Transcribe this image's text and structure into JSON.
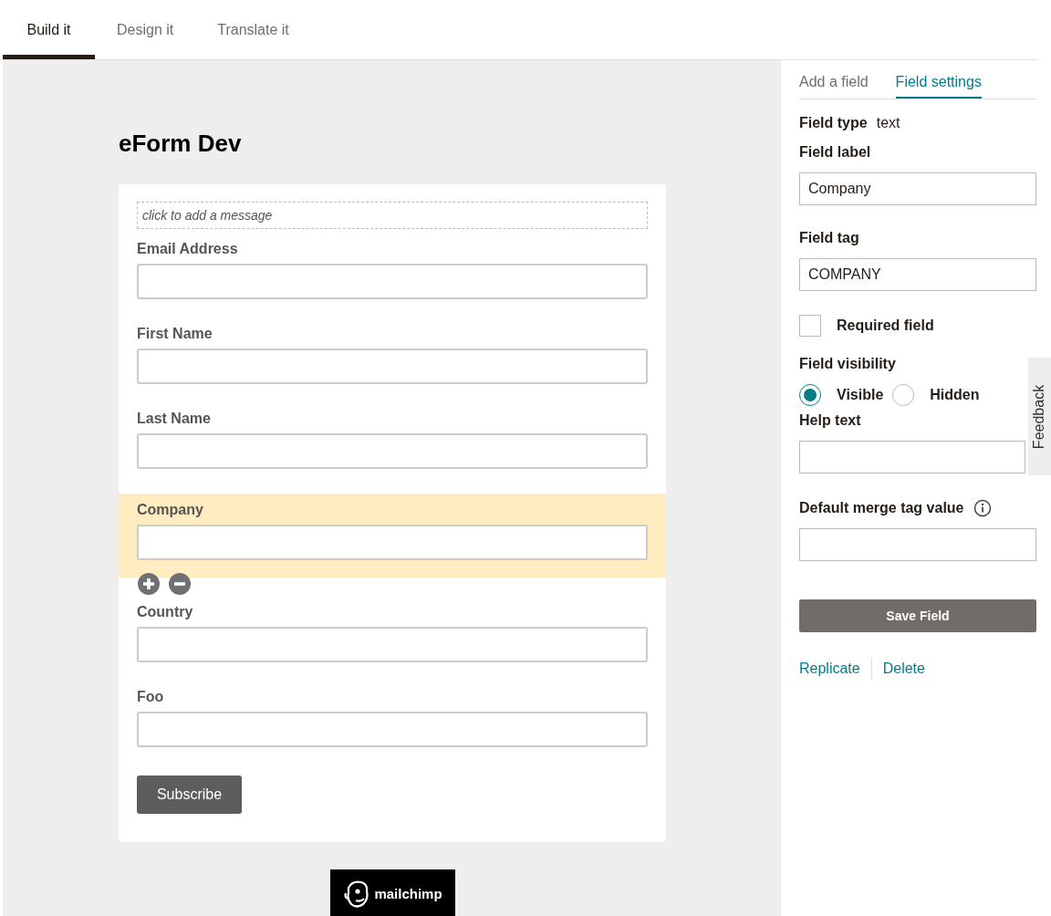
{
  "tabs": [
    {
      "label": "Build it",
      "selected": true
    },
    {
      "label": "Design it",
      "selected": false
    },
    {
      "label": "Translate it",
      "selected": false
    }
  ],
  "form": {
    "title": "eForm Dev",
    "message_placeholder": "click to add a message",
    "fields": [
      {
        "label": "Email Address",
        "selected": false
      },
      {
        "label": "First Name",
        "selected": false
      },
      {
        "label": "Last Name",
        "selected": false
      },
      {
        "label": "Company",
        "selected": true
      },
      {
        "label": "Country",
        "selected": false
      },
      {
        "label": "Foo",
        "selected": false
      }
    ],
    "submit": "Subscribe"
  },
  "badge": {
    "text": "mailchimp"
  },
  "panel": {
    "tabs": [
      {
        "label": "Add a field",
        "selected": false
      },
      {
        "label": "Field settings",
        "selected": true
      }
    ],
    "field_type_label": "Field type",
    "field_type": "text",
    "field_label": {
      "label": "Field label",
      "value": "Company"
    },
    "field_tag": {
      "label": "Field tag",
      "value": "COMPANY"
    },
    "required": {
      "label": "Required field",
      "checked": false
    },
    "visibility": {
      "label": "Field visibility",
      "options": [
        {
          "label": "Visible",
          "selected": true
        },
        {
          "label": "Hidden",
          "selected": false
        }
      ]
    },
    "help_text": {
      "label": "Help text"
    },
    "default_value": {
      "label": "Default merge tag value"
    },
    "save": "Save Field",
    "links": [
      "Replicate",
      "Delete"
    ]
  },
  "feedback": "Feedback"
}
